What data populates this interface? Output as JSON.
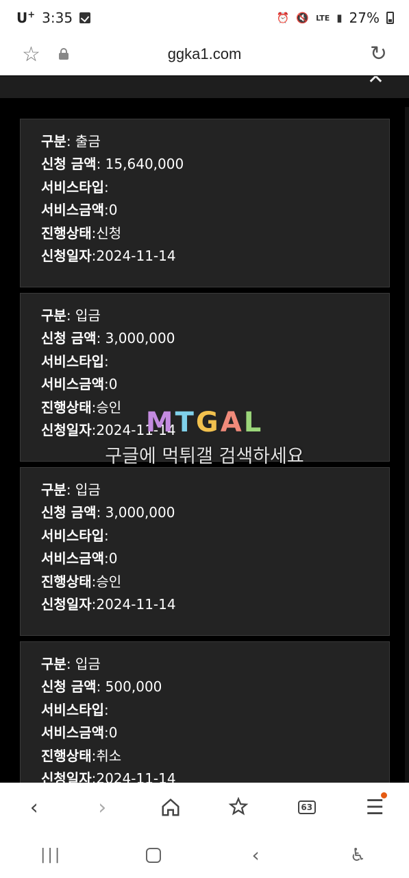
{
  "status_bar": {
    "carrier": "U",
    "carrier_sup": "+",
    "time": "3:35",
    "network": "LTE",
    "battery": "27%"
  },
  "url_bar": {
    "url": "ggka1.com"
  },
  "records": [
    {
      "type_label": "구분",
      "type_value": " 출금",
      "amount_label": "신청 금액",
      "amount_value": " 15,640,000",
      "service_type_label": "서비스타입",
      "service_type_value": "",
      "service_amount_label": "서비스금액",
      "service_amount_value": "0",
      "status_label": "진행상태",
      "status_value": "신청",
      "date_label": "신청일자",
      "date_value": "2024-11-14"
    },
    {
      "type_label": "구분",
      "type_value": " 입금",
      "amount_label": "신청 금액",
      "amount_value": " 3,000,000",
      "service_type_label": "서비스타입",
      "service_type_value": "",
      "service_amount_label": "서비스금액",
      "service_amount_value": "0",
      "status_label": "진행상태",
      "status_value": "승인",
      "date_label": "신청일자",
      "date_value": "2024-11-14"
    },
    {
      "type_label": "구분",
      "type_value": " 입금",
      "amount_label": "신청 금액",
      "amount_value": " 3,000,000",
      "service_type_label": "서비스타입",
      "service_type_value": "",
      "service_amount_label": "서비스금액",
      "service_amount_value": "0",
      "status_label": "진행상태",
      "status_value": "승인",
      "date_label": "신청일자",
      "date_value": "2024-11-14"
    },
    {
      "type_label": "구분",
      "type_value": " 입금",
      "amount_label": "신청 금액",
      "amount_value": " 500,000",
      "service_type_label": "서비스타입",
      "service_type_value": "",
      "service_amount_label": "서비스금액",
      "service_amount_value": "0",
      "status_label": "진행상태",
      "status_value": "취소",
      "date_label": "신청일자",
      "date_value": "2024-11-14"
    }
  ],
  "watermark": {
    "logo": "MTGAL",
    "text": "구글에 먹튀갤 검색하세요"
  },
  "toolbar": {
    "tabs_count": "63"
  },
  "colors": {
    "card_bg": "#232323",
    "page_bg": "#000000",
    "menu_badge": "#e55b13"
  }
}
